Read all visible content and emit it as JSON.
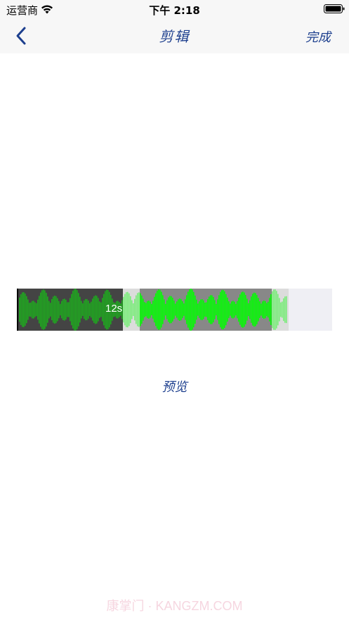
{
  "status_bar": {
    "carrier": "运营商",
    "time": "下午 2:18",
    "icons": [
      "wifi-icon",
      "battery-icon"
    ]
  },
  "nav": {
    "back_icon": "chevron-left-icon",
    "title": "剪辑",
    "done_label": "完成"
  },
  "editor": {
    "time_label": "12s",
    "colors": {
      "waveform": "#00ff00",
      "played_region": "#444444",
      "selected_region": "#888888",
      "handle": "#dcdcdc",
      "track": "#efeff4",
      "accent": "#1d3f8e"
    }
  },
  "actions": {
    "preview_label": "预览"
  },
  "watermark": "康掌门 · KANGZM.COM"
}
